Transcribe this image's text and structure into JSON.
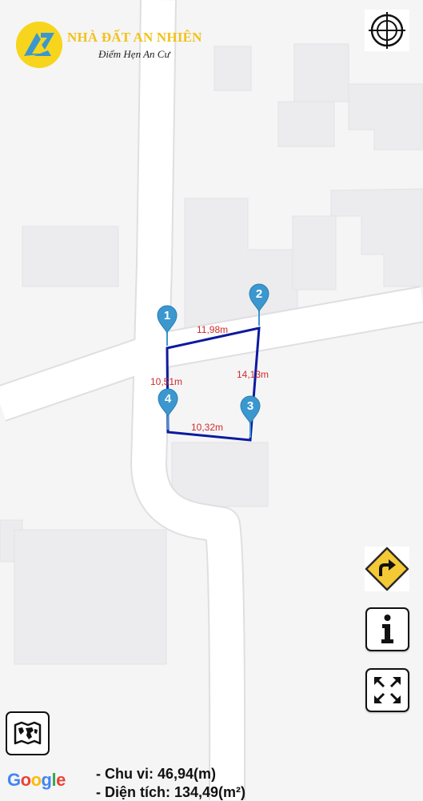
{
  "brand": {
    "name": "NHÀ ĐẤT AN NHIÊN",
    "tagline": "Điểm Hẹn An Cư",
    "primary_color": "#f7d51c",
    "accent_color": "#3b97cf"
  },
  "map": {
    "provider": "Google",
    "plot": {
      "outline_color": "#0d1a9e",
      "label_color": "#d22a2a",
      "edges": [
        {
          "from": "1",
          "to": "2",
          "length": "11,98m"
        },
        {
          "from": "2",
          "to": "3",
          "length": "14,13m"
        },
        {
          "from": "3",
          "to": "4",
          "length": "10,32m"
        },
        {
          "from": "4",
          "to": "1",
          "length": "10,51m"
        }
      ],
      "markers": [
        "1",
        "2",
        "3",
        "4"
      ],
      "marker_color": "#3b97cf"
    }
  },
  "controls": {
    "locate": "crosshair-icon",
    "directions": "turn-right-icon",
    "info": "info-icon",
    "fullscreen": "expand-icon",
    "map_type": "map-layers-icon"
  },
  "summary": {
    "perimeter": "- Chu vi: 46,94(m)",
    "area": "- Diện tích: 134,49(m²)"
  }
}
